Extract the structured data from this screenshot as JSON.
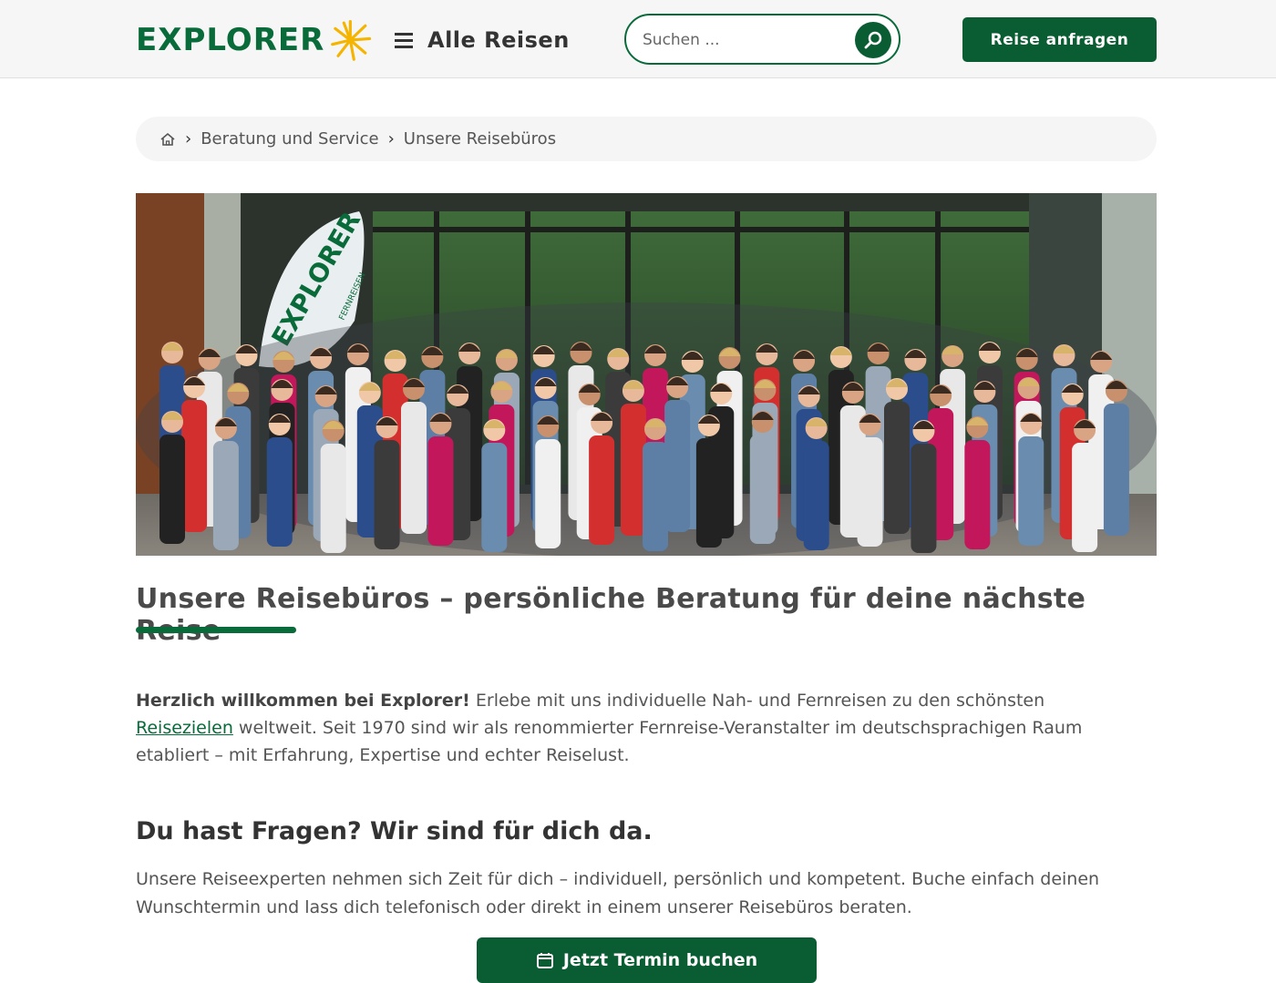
{
  "header": {
    "logo_text": "EXPLORER",
    "menu_label": "Alle Reisen",
    "search_placeholder": "Suchen ...",
    "cta_label": "Reise anfragen"
  },
  "breadcrumb": {
    "items": [
      "Beratung und Service",
      "Unsere Reisebüros"
    ]
  },
  "hero": {
    "banner_text": "EXPLORER",
    "banner_subtext": "FERNREISEN"
  },
  "main": {
    "title": "Unsere Reisebüros – persönliche Beratung für deine nächste Reise",
    "intro_bold": "Herzlich willkommen bei Explorer!",
    "intro_text_1": " Erlebe mit uns individuelle Nah- und Fernreisen zu den schönsten ",
    "intro_link": "Reisezielen",
    "intro_text_2": " weltweit. Seit 1970 sind wir als renommierter Fernreise-Veranstalter im deutschsprachigen Raum etabliert – mit Erfahrung, Expertise und echter Reiselust.",
    "subtitle": "Du hast Fragen? Wir sind für dich da.",
    "paragraph": "Unsere Reiseexperten nehmen sich Zeit für dich – individuell, persönlich und kompetent. Buche einfach deinen Wunschtermin und lass dich telefonisch oder direkt in einem unserer Reisebüros beraten.",
    "button_label": "Jetzt Termin buchen"
  },
  "colors": {
    "brand_green": "#0a6b3a",
    "button_green": "#0a5d33",
    "sun_yellow": "#f5b400"
  }
}
